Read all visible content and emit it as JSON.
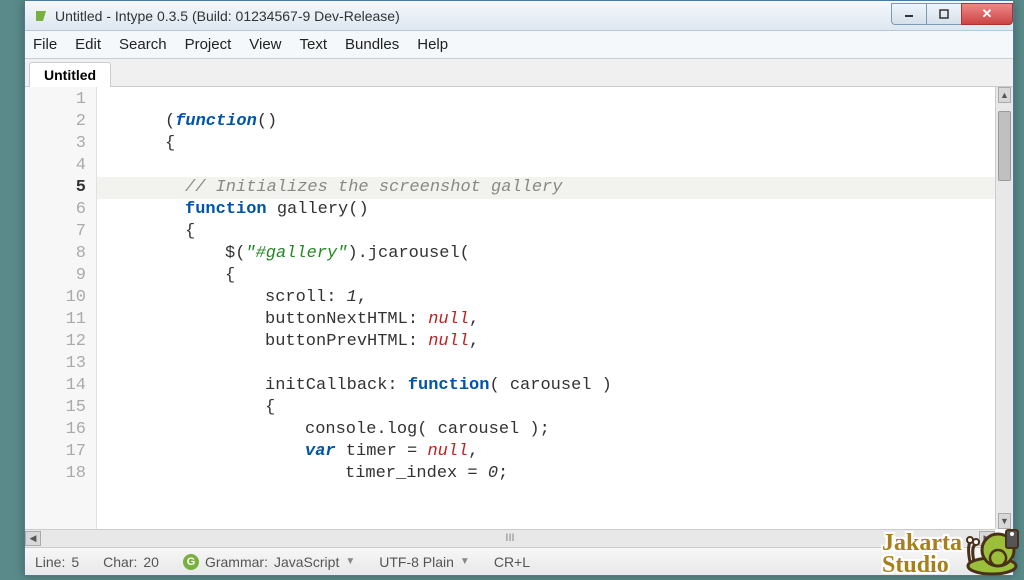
{
  "window": {
    "title": "Untitled - Intype 0.3.5 (Build: 01234567-9 Dev-Release)"
  },
  "menu": [
    "File",
    "Edit",
    "Search",
    "Project",
    "View",
    "Text",
    "Bundles",
    "Help"
  ],
  "tab": {
    "label": "Untitled"
  },
  "code": {
    "current_line_index": 4,
    "lines": [
      {
        "n": 1,
        "i": 0,
        "t": ""
      },
      {
        "n": 2,
        "i": 6,
        "t": "(<kw>function</kw>()"
      },
      {
        "n": 3,
        "i": 6,
        "t": "{"
      },
      {
        "n": 4,
        "i": 0,
        "t": ""
      },
      {
        "n": 5,
        "i": 8,
        "t": "<cm>// Initializes the screenshot gallery</cm>"
      },
      {
        "n": 6,
        "i": 8,
        "t": "<fn>function</fn> gallery()"
      },
      {
        "n": 7,
        "i": 8,
        "t": "{"
      },
      {
        "n": 8,
        "i": 12,
        "t": "$(<str>\"#gallery\"</str>).jcarousel("
      },
      {
        "n": 9,
        "i": 12,
        "t": "{"
      },
      {
        "n": 10,
        "i": 16,
        "t": "scroll: <num>1</num>,"
      },
      {
        "n": 11,
        "i": 16,
        "t": "buttonNextHTML: <nl>null</nl>,"
      },
      {
        "n": 12,
        "i": 16,
        "t": "buttonPrevHTML: <nl>null</nl>,"
      },
      {
        "n": 13,
        "i": 0,
        "t": ""
      },
      {
        "n": 14,
        "i": 16,
        "t": "initCallback: <fn>function</fn>( carousel )"
      },
      {
        "n": 15,
        "i": 16,
        "t": "{"
      },
      {
        "n": 16,
        "i": 20,
        "t": "console.log( carousel );"
      },
      {
        "n": 17,
        "i": 20,
        "t": "<kw>var</kw> timer = <nl>null</nl>,"
      },
      {
        "n": 18,
        "i": 24,
        "t": "timer_index = <num>0</num>;"
      }
    ]
  },
  "status": {
    "line_label": "Line:",
    "line": "5",
    "char_label": "Char:",
    "char": "20",
    "grammar_label": "Grammar:",
    "grammar": "JavaScript",
    "encoding": "UTF-8 Plain",
    "lineending": "CR+L"
  },
  "hscroll_center": "III",
  "watermark": {
    "line1": "Jakarta",
    "line2": "Studio"
  }
}
